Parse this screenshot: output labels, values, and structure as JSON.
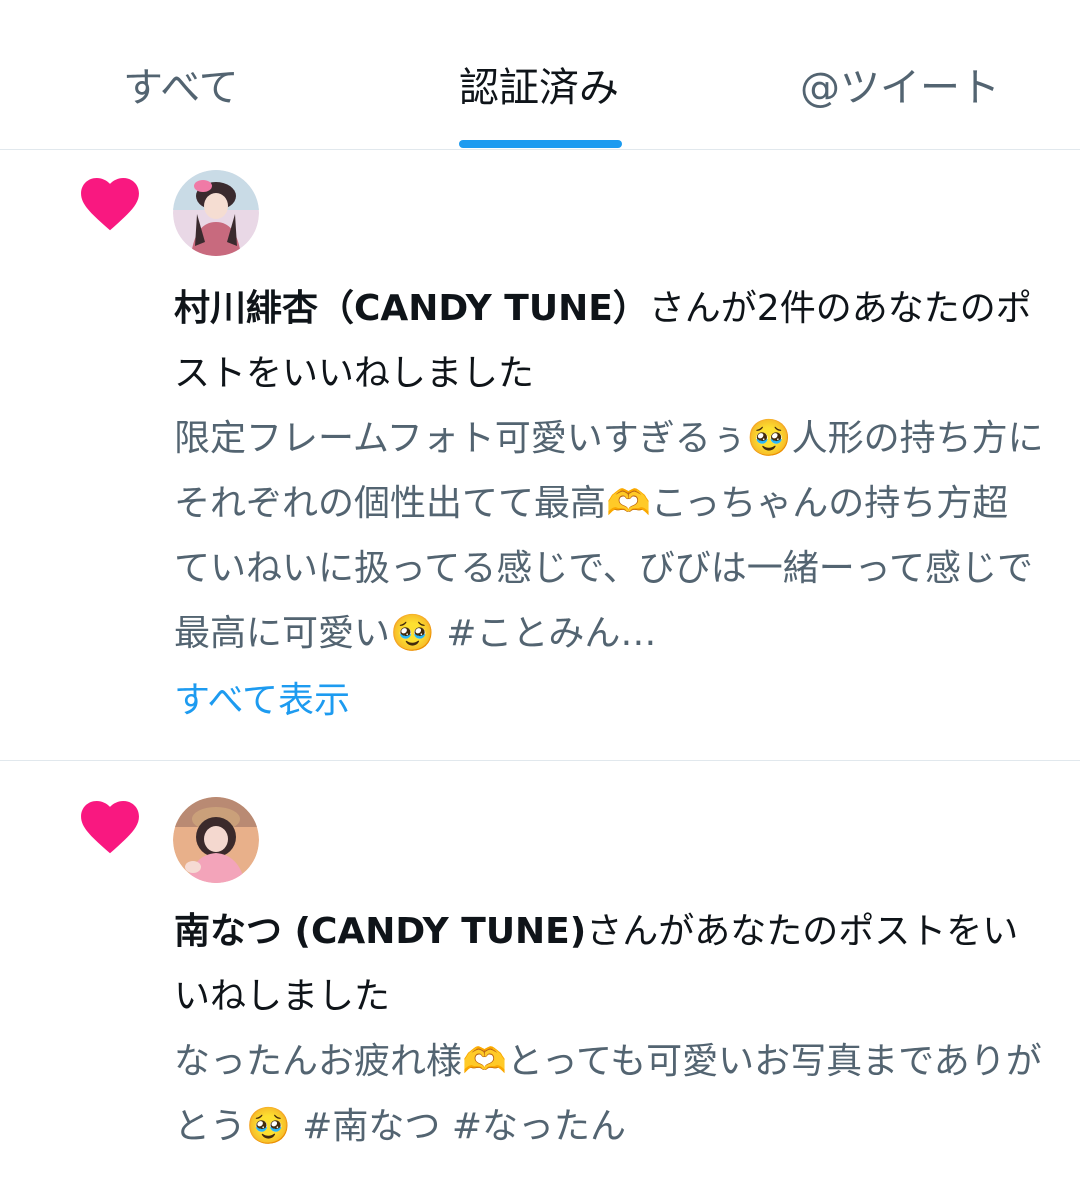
{
  "tabs": [
    {
      "label": "すべて",
      "active": false
    },
    {
      "label": "認証済み",
      "active": true
    },
    {
      "label": "@ツイート",
      "active": false
    }
  ],
  "colors": {
    "accent": "#1d9bf0",
    "heart": "#f91880",
    "secondary_text": "#536471"
  },
  "notifications": [
    {
      "icon": "heart-icon",
      "user_name": "村川緋杏（CANDY TUNE）",
      "action": "さんが2件のあなたのポストをいいねしました",
      "snippet": "限定フレームフォト可愛いすぎるぅ🥹人形の持ち方にそれぞれの個性出てて最高🫶こっちゃんの持ち方超ていねいに扱ってる感じで、びびは一緒ーって感じで最高に可愛い🥹 #ことみん…",
      "show_all": "すべて表示"
    },
    {
      "icon": "heart-icon",
      "user_name": "南なつ (CANDY TUNE)",
      "action": "さんがあなたのポストをいいねしました",
      "snippet": "なったんお疲れ様🫶とっても可愛いお写真までありがとう🥹 #南なつ #なったん"
    }
  ]
}
